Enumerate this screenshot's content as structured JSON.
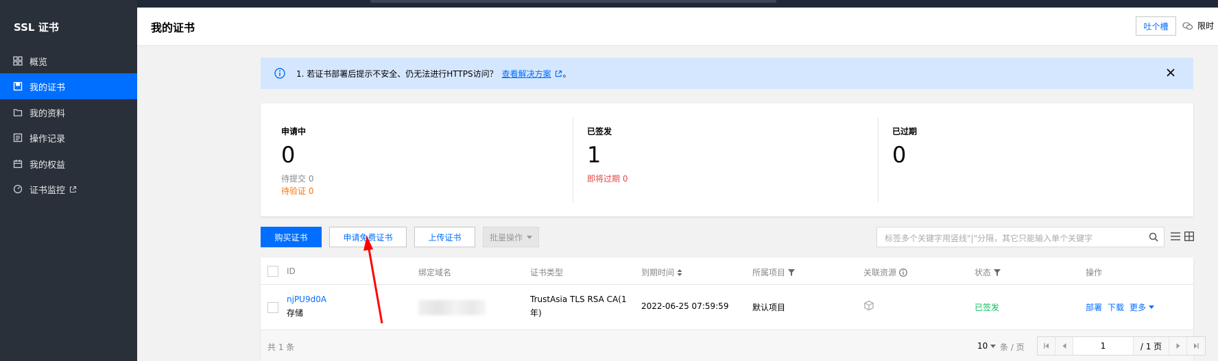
{
  "sidebar": {
    "title": "SSL 证书",
    "items": [
      {
        "label": "概览",
        "icon": "grid-icon"
      },
      {
        "label": "我的证书",
        "icon": "certificate-icon",
        "active": true
      },
      {
        "label": "我的资料",
        "icon": "folder-icon"
      },
      {
        "label": "操作记录",
        "icon": "log-icon"
      },
      {
        "label": "我的权益",
        "icon": "calendar-icon"
      },
      {
        "label": "证书监控",
        "icon": "monitor-icon",
        "external": true
      }
    ]
  },
  "header": {
    "title": "我的证书",
    "feedback_label": "吐个槽",
    "limited_label": "限时"
  },
  "notice": {
    "text": "1. 若证书部署后提示不安全、仍无法进行HTTPS访问？",
    "link": "查看解决方案",
    "suffix": "。"
  },
  "stats": {
    "applying": {
      "label": "申请中",
      "value": "0",
      "pending_submit": "待提交 0",
      "pending_verify": "待验证 0"
    },
    "issued": {
      "label": "已签发",
      "value": "1",
      "expiring": "即将过期 0"
    },
    "expired": {
      "label": "已过期",
      "value": "0"
    }
  },
  "toolbar": {
    "buy_label": "购买证书",
    "apply_free_label": "申请免费证书",
    "upload_label": "上传证书",
    "batch_label": "批量操作",
    "search_placeholder": "标签多个关键字用竖线\"|\"分隔，其它只能输入单个关键字"
  },
  "table": {
    "columns": [
      "ID",
      "绑定域名",
      "证书类型",
      "到期时间",
      "所属项目",
      "关联资源",
      "状态",
      "操作"
    ],
    "rows": [
      {
        "id": "njPU9d0A",
        "remark": "存储",
        "cert_type_line1": "TrustAsia TLS RSA CA(1",
        "cert_type_line2": "年)",
        "expire": "2022-06-25 07:59:59",
        "project": "默认项目",
        "status": "已签发",
        "actions": {
          "deploy": "部署",
          "download": "下载",
          "more": "更多"
        }
      }
    ]
  },
  "footer": {
    "total": "共 1 条",
    "page_size": "10",
    "per_page": "条 / 页",
    "current_page": "1",
    "total_pages": "/ 1 页"
  },
  "colors": {
    "primary": "#006eff",
    "sidebar_bg": "#293039",
    "success": "#0abf5b",
    "warning": "#ff7200",
    "danger": "#e54545",
    "notice_bg": "#d5e7ff",
    "annotation_arrow": "#ff0000"
  }
}
